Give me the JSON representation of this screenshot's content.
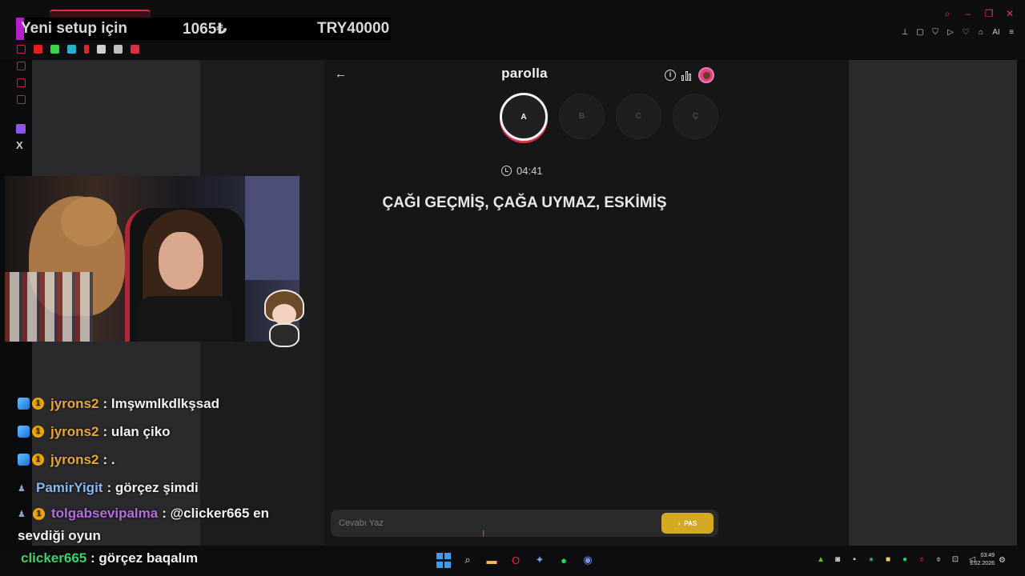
{
  "overlay_banner": {
    "title": "Yeni setup için",
    "amount_lira": "1065₺",
    "goal": "TRY40000"
  },
  "game": {
    "title": "parolla",
    "letters": [
      "A",
      "B",
      "C",
      "Ç"
    ],
    "active_letter_index": 0,
    "timer": "04:41",
    "question": "ÇAĞI GEÇMİŞ, ÇAĞA UYMAZ, ESKİMİŞ",
    "answer_placeholder": "Cevabı Yaz",
    "pass_button": "PAS",
    "pass_chevron": "›",
    "back_icon": "arrow-left-icon",
    "info_icon": "info-icon",
    "stats_icon": "bar-chart-icon"
  },
  "chat": {
    "messages": [
      {
        "user": "jyrons2",
        "text": ": lmşwmlkdlkşsad",
        "badges": [
          "cube",
          "one"
        ]
      },
      {
        "user": "jyrons2",
        "text": ": ulan çiko",
        "badges": [
          "cube",
          "one"
        ]
      },
      {
        "user": "jyrons2",
        "text": ": .",
        "badges": [
          "cube",
          "one"
        ]
      },
      {
        "user": "PamirYigit",
        "text": ": görçez şimdi",
        "badges": [
          "person"
        ]
      },
      {
        "user": "tolgabsevipalma",
        "text": ": @clicker665 en",
        "badges": [
          "person",
          "one"
        ]
      },
      {
        "user": "",
        "text": "sevdiği oyun",
        "badges": []
      }
    ],
    "last": {
      "user": "clicker665",
      "text": ": görçez baqalım"
    }
  },
  "taskbar": {
    "time": "03:49",
    "date": "9.02.2026"
  },
  "toolbar_extra": {
    "ai_label": "AI"
  },
  "colors": {
    "accent_red": "#e0304a",
    "pass_yellow": "#d4aa25",
    "username_orange": "#e8a73a",
    "username_blue": "#8ab8ee",
    "username_purple": "#b46de0",
    "username_green": "#39d46a"
  }
}
